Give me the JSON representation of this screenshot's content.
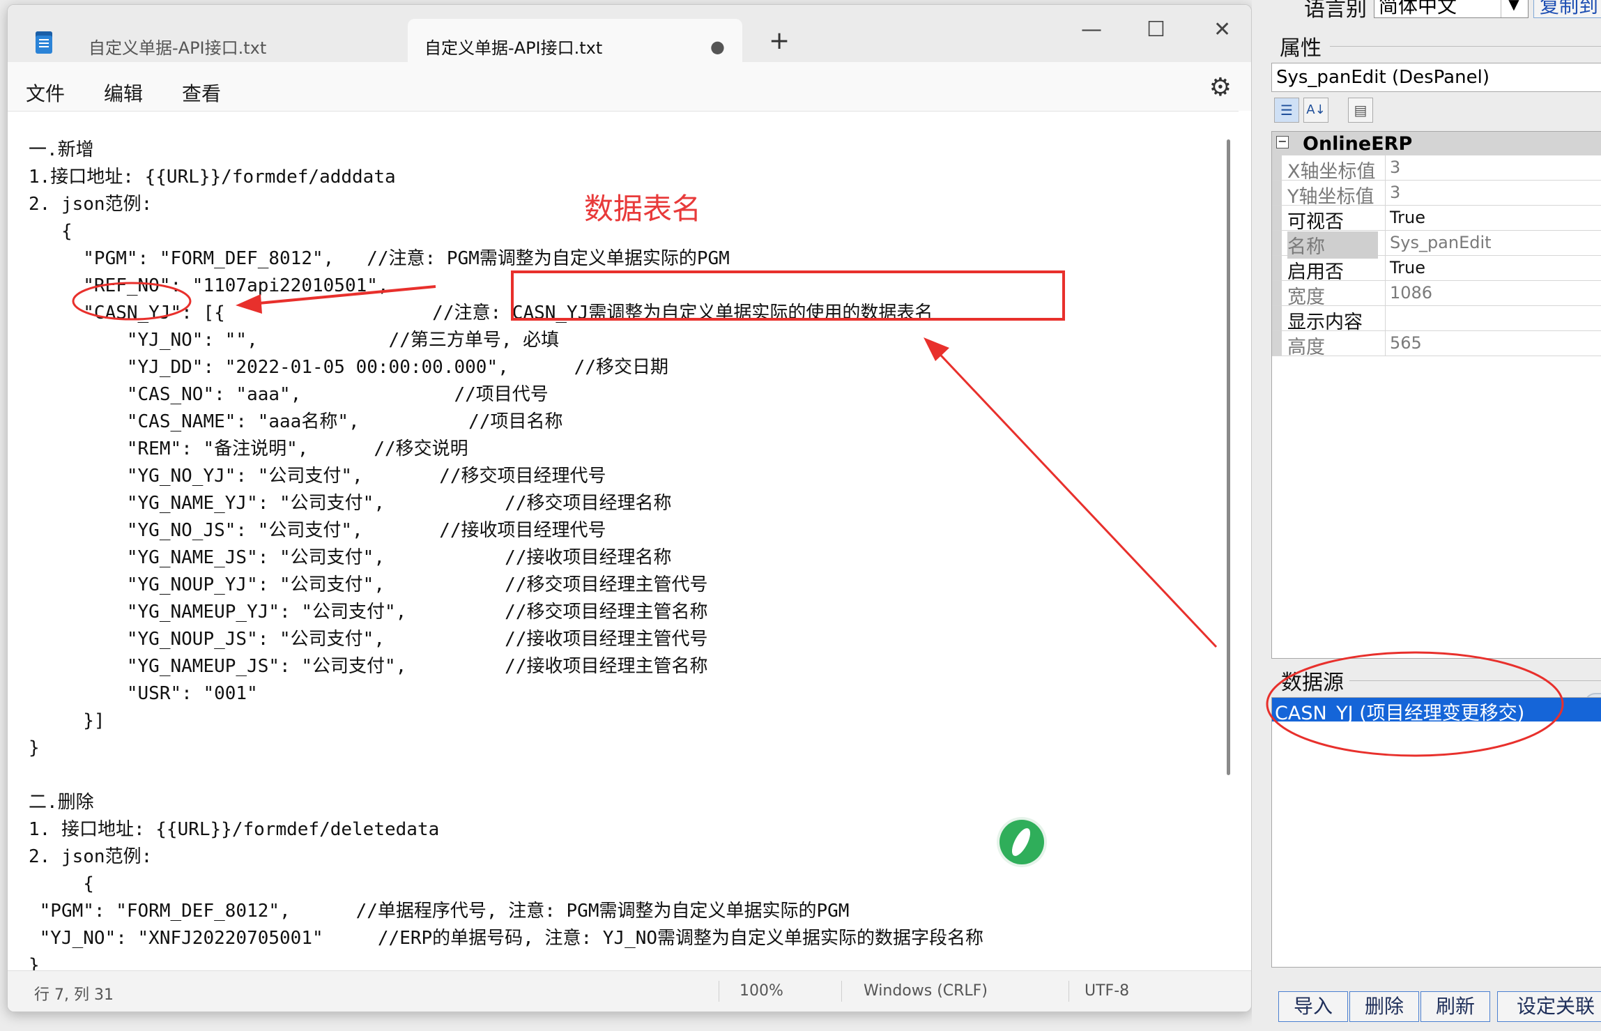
{
  "notepad": {
    "tabs": [
      {
        "label": "自定义单据-API接口.txt"
      },
      {
        "label": "自定义单据-API接口.txt",
        "modified_dot": "●"
      }
    ],
    "new_tab": "+",
    "window_controls": {
      "minimize": "—",
      "maximize": "☐",
      "close": "✕"
    },
    "menu": {
      "file": "文件",
      "edit": "编辑",
      "view": "查看"
    },
    "settings_icon": "⚙",
    "lines": [
      "一.新增",
      "1.接口地址: {{URL}}/formdef/adddata",
      "2. json范例:",
      "   {",
      "     \"PGM\": \"FORM_DEF_8012\",   //注意: PGM需调整为自定义单据实际的PGM",
      "     \"REF_NO\": \"1107api22010501\",",
      "     \"CASN_YJ\": [{                   //注意: CASN_YJ需调整为自定义单据实际的使用的数据表名",
      "         \"YJ_NO\": \"\",            //第三方单号, 必填",
      "         \"YJ_DD\": \"2022-01-05 00:00:00.000\",      //移交日期",
      "         \"CAS_NO\": \"aaa\",              //项目代号",
      "         \"CAS_NAME\": \"aaa名称\",          //项目名称",
      "         \"REM\": \"备注说明\",      //移交说明",
      "         \"YG_NO_YJ\": \"公司支付\",       //移交项目经理代号",
      "         \"YG_NAME_YJ\": \"公司支付\",           //移交项目经理名称",
      "         \"YG_NO_JS\": \"公司支付\",       //接收项目经理代号",
      "         \"YG_NAME_JS\": \"公司支付\",           //接收项目经理名称",
      "         \"YG_NOUP_YJ\": \"公司支付\",           //移交项目经理主管代号",
      "         \"YG_NAMEUP_YJ\": \"公司支付\",         //移交项目经理主管名称",
      "         \"YG_NOUP_JS\": \"公司支付\",           //接收项目经理主管代号",
      "         \"YG_NAMEUP_JS\": \"公司支付\",         //接收项目经理主管名称",
      "         \"USR\": \"001\"",
      "     }]",
      "}",
      "",
      "二.删除",
      "1. 接口地址: {{URL}}/formdef/deletedata",
      "2. json范例:",
      "     {",
      " \"PGM\": \"FORM_DEF_8012\",      //单据程序代号, 注意: PGM需调整为自定义单据实际的PGM",
      " \"YJ_NO\": \"XNFJ20220705001\"     //ERP的单据号码, 注意: YJ_NO需调整为自定义单据实际的数据字段名称",
      "}"
    ],
    "status": {
      "position": "行 7, 列 31",
      "zoom": "100%",
      "line_ending": "Windows (CRLF)",
      "encoding": "UTF-8"
    }
  },
  "annotations": {
    "title": "数据表名",
    "color": "#e8302c"
  },
  "designer": {
    "language_label": "语言别",
    "language_value": "简体中文",
    "copy_button": "复制到",
    "properties_heading": "属性",
    "object_select": "Sys_panEdit (DesPanel)",
    "toolbar_icons": [
      "categorized-icon",
      "alphabetical-icon",
      "property-pages-icon"
    ],
    "category": {
      "toggle": "⊟",
      "label": "OnlineERP"
    },
    "properties": [
      {
        "name": "X轴坐标值",
        "value": "3",
        "state": "dim"
      },
      {
        "name": "Y轴坐标值",
        "value": "3",
        "state": "dim"
      },
      {
        "name": "可视否",
        "value": "True",
        "state": "normal"
      },
      {
        "name": "名称",
        "value": "Sys_panEdit",
        "state": "dim-selected"
      },
      {
        "name": "启用否",
        "value": "True",
        "state": "normal"
      },
      {
        "name": "宽度",
        "value": "1086",
        "state": "dim"
      },
      {
        "name": "显示内容",
        "value": "",
        "state": "normal"
      },
      {
        "name": "高度",
        "value": "565",
        "state": "dim"
      }
    ],
    "datasource_heading": "数据源",
    "datasource_selected": "CASN_YJ (项目经理变更移交)",
    "buttons": {
      "import": "导入",
      "delete": "删除",
      "refresh": "刷新",
      "relate": "设定关联"
    }
  }
}
